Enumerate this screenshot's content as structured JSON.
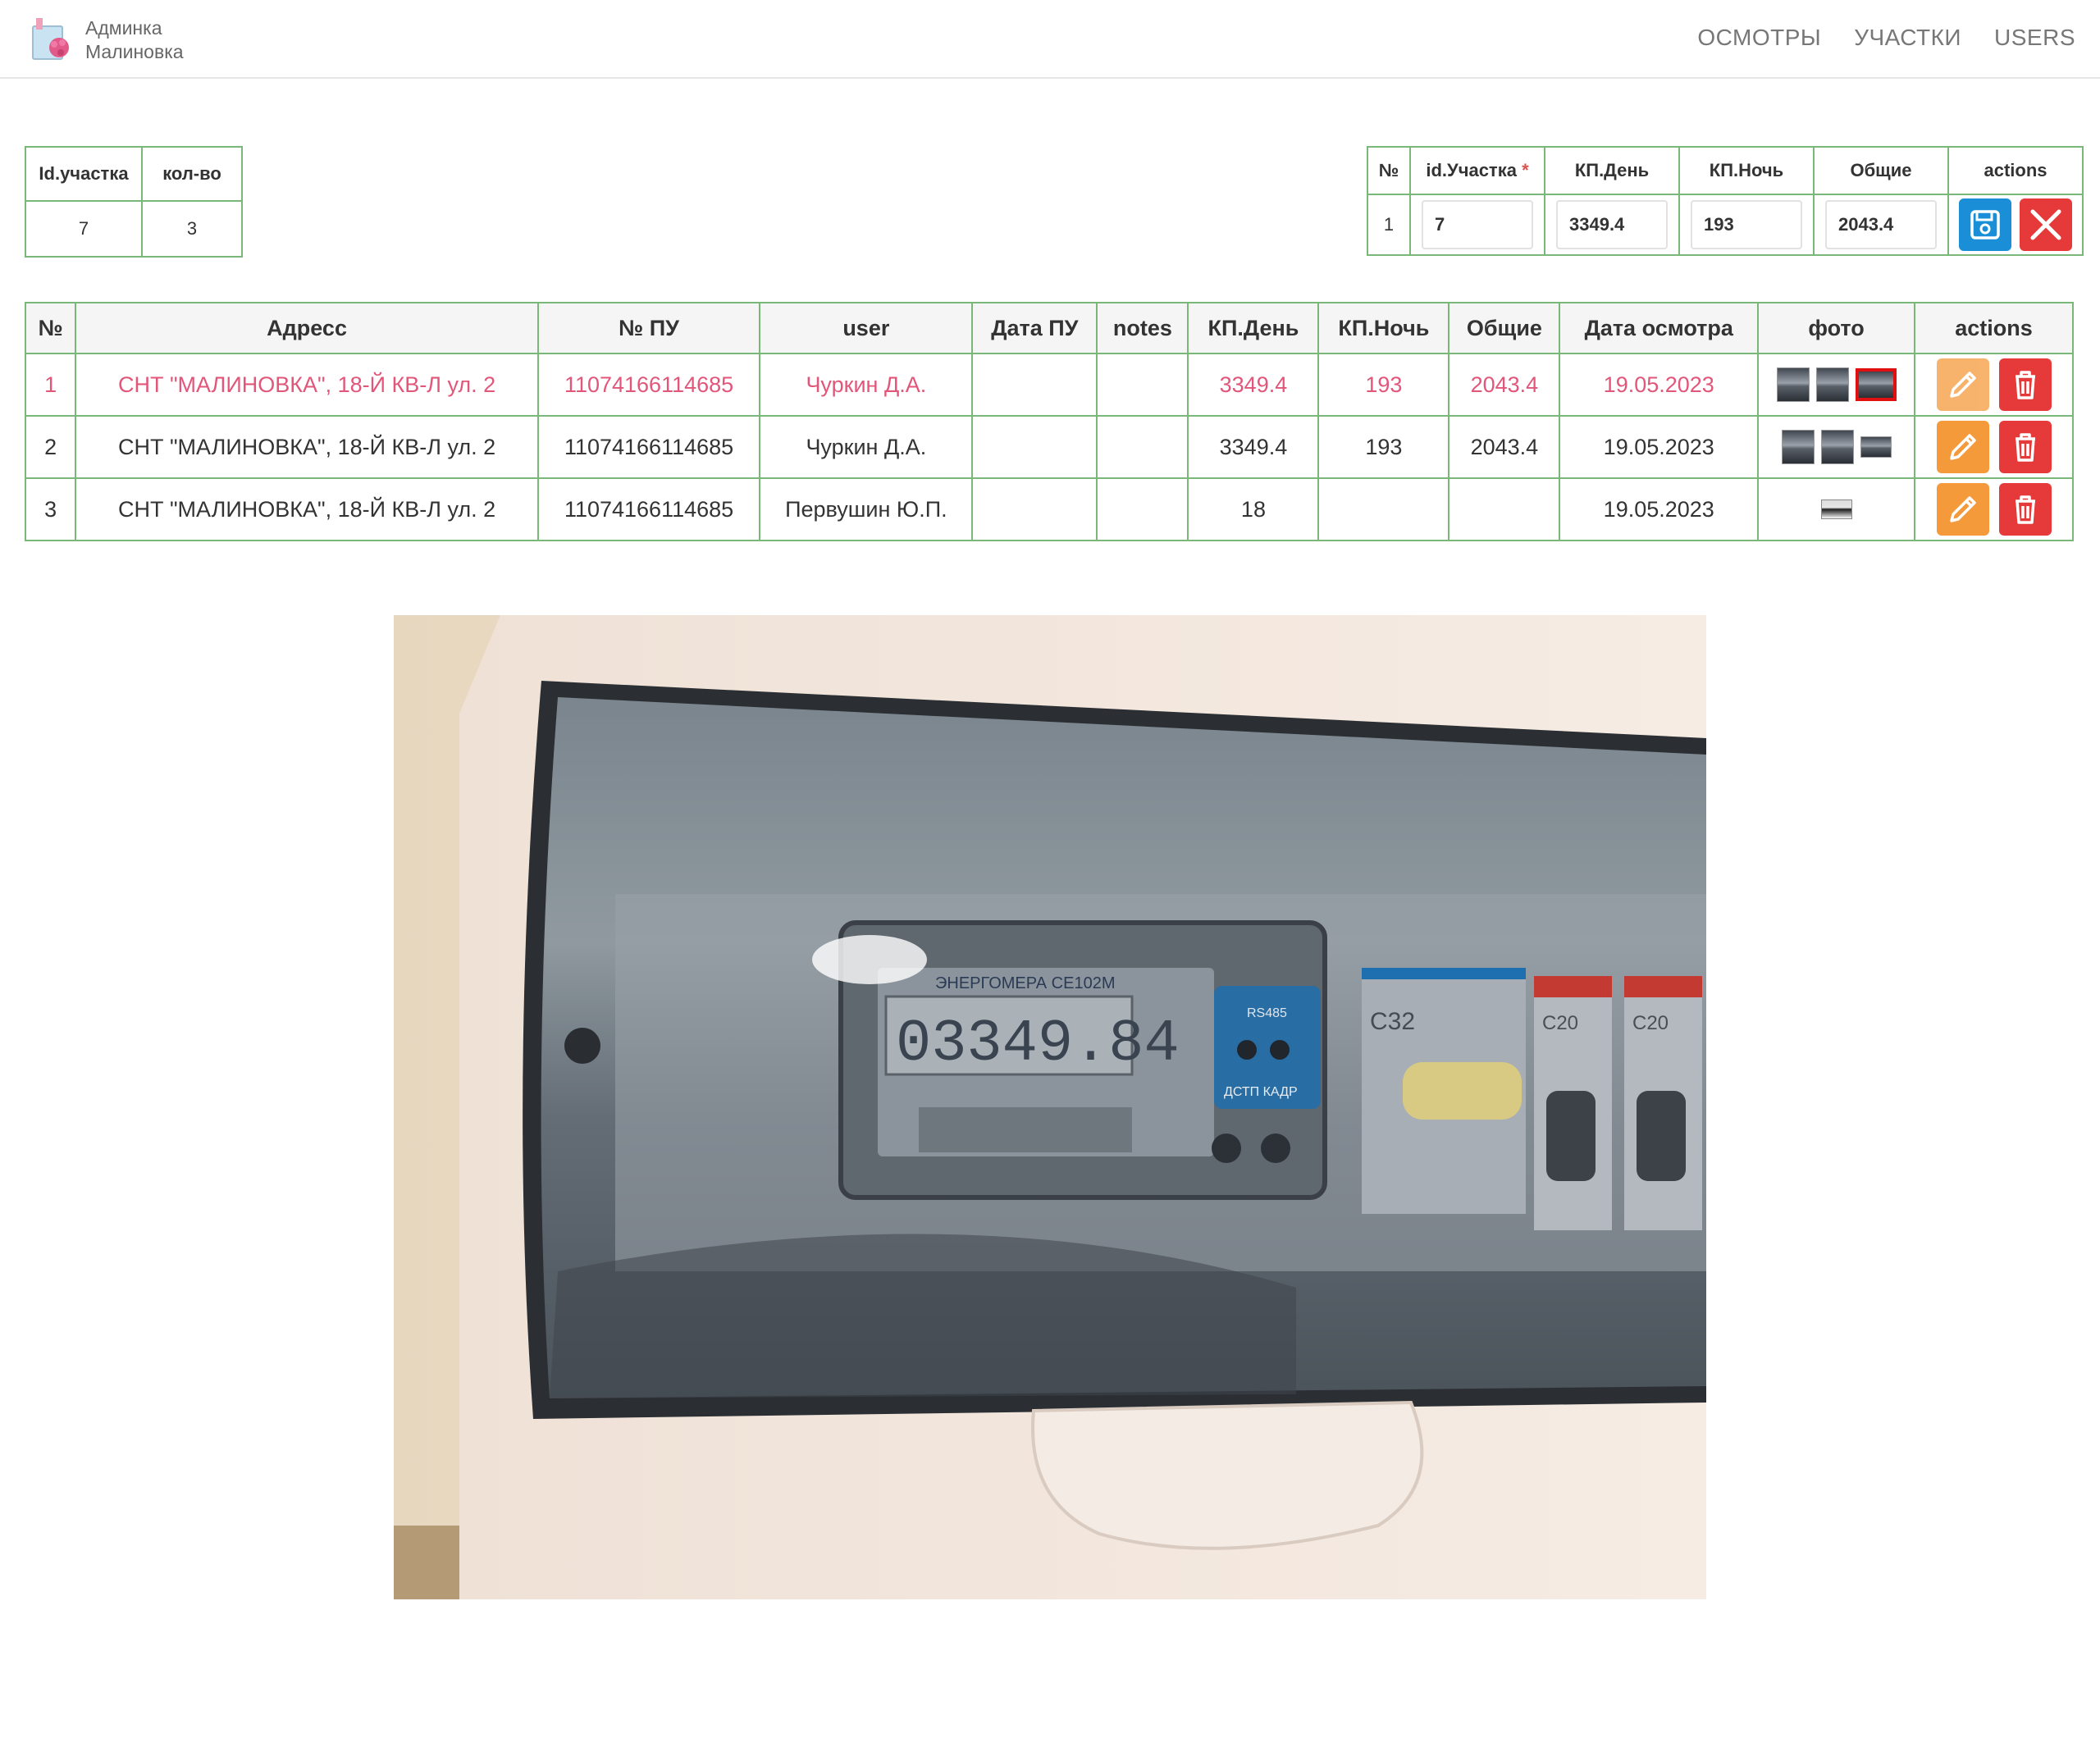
{
  "header": {
    "brand_line1": "Админка",
    "brand_line2": "Малиновка",
    "nav": [
      "ОСМОТРЫ",
      "УЧАСТКИ",
      "USERS"
    ]
  },
  "summary_table": {
    "headers": [
      "Id.участка",
      "кол-во"
    ],
    "row": [
      "7",
      "3"
    ]
  },
  "edit_table": {
    "headers": [
      "№",
      "id.Участка",
      "КП.День",
      "КП.Ночь",
      "Общие",
      "actions"
    ],
    "required_mark": "*",
    "row": {
      "num": "1",
      "id": "7",
      "kp_day": "3349.4",
      "kp_night": "193",
      "total": "2043.4"
    }
  },
  "main_table": {
    "headers": [
      "№",
      "Адресс",
      "№ ПУ",
      "user",
      "Дата ПУ",
      "notes",
      "КП.День",
      "КП.Ночь",
      "Общие",
      "Дата осмотра",
      "фото",
      "actions"
    ],
    "rows": [
      {
        "num": "1",
        "address": "СНТ \"МАЛИНОВКА\", 18-Й КВ-Л ул. 2",
        "pu": "11074166114685",
        "user": "Чуркин Д.А.",
        "date_pu": "",
        "notes": "",
        "kp_day": "3349.4",
        "kp_night": "193",
        "total": "2043.4",
        "date": "19.05.2023"
      },
      {
        "num": "2",
        "address": "СНТ \"МАЛИНОВКА\", 18-Й КВ-Л ул. 2",
        "pu": "11074166114685",
        "user": "Чуркин Д.А.",
        "date_pu": "",
        "notes": "",
        "kp_day": "3349.4",
        "kp_night": "193",
        "total": "2043.4",
        "date": "19.05.2023"
      },
      {
        "num": "3",
        "address": "СНТ \"МАЛИНОВКА\", 18-Й КВ-Л ул. 2",
        "pu": "11074166114685",
        "user": "Первушин Ю.П.",
        "date_pu": "",
        "notes": "",
        "kp_day": "18",
        "kp_night": "",
        "total": "",
        "date": "19.05.2023"
      }
    ]
  },
  "photo": {
    "meter_reading": "03349.84",
    "meter_model": "ЭНЕРГОМЕРА СЕ102М",
    "breaker_label": "C32",
    "breaker_small": [
      "C20",
      "C20"
    ],
    "port_label": "RS485",
    "buttons_label": "ДСТП КАДР"
  },
  "colors": {
    "border": "#79b879",
    "active_row": "#e2567a",
    "save": "#1a8fd8",
    "danger": "#e63a3a",
    "edit": "#f59a3b"
  }
}
